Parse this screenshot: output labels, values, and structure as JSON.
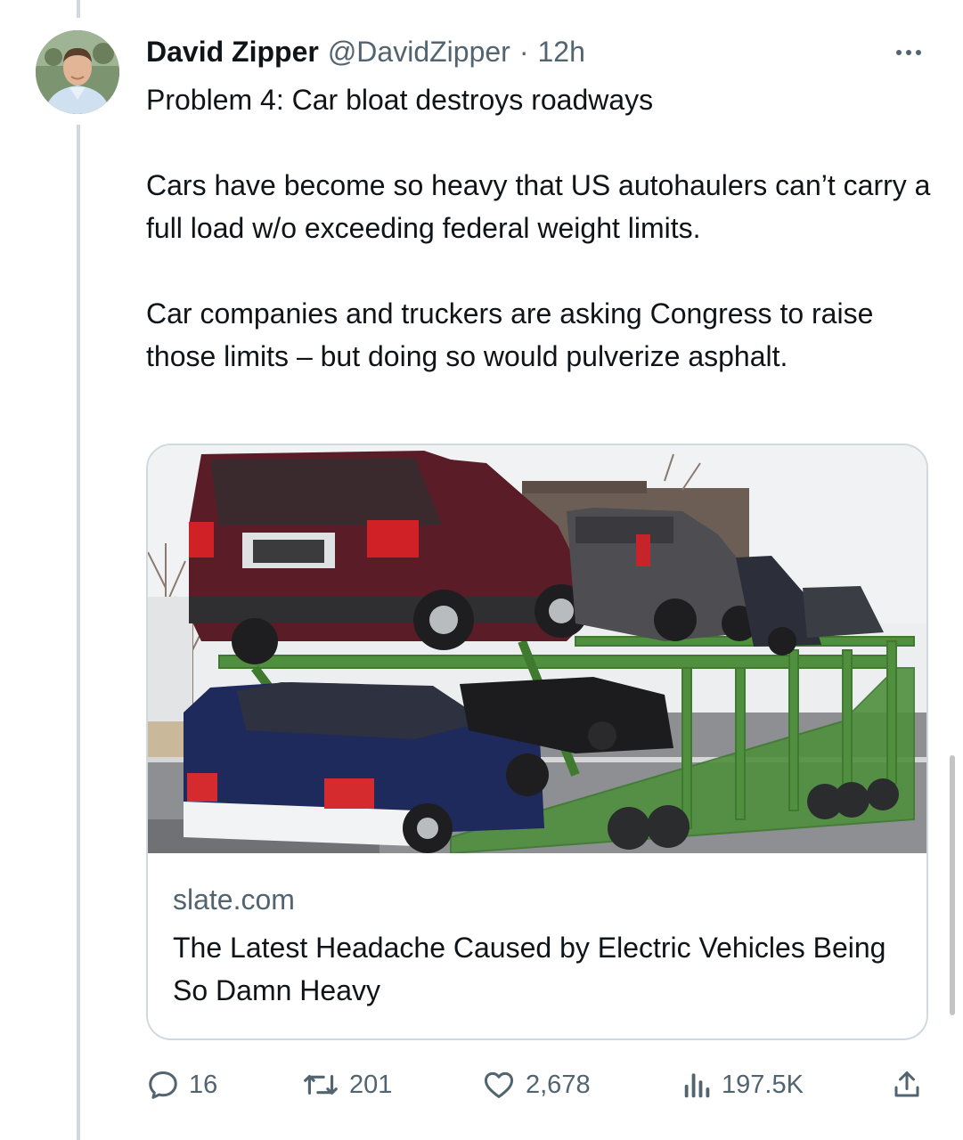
{
  "tweet": {
    "author_name": "David Zipper",
    "author_handle": "@DavidZipper",
    "separator": "·",
    "time": "12h",
    "text": "Problem 4: Car bloat destroys roadways\n\nCars have become so heavy that US autohaulers can’t carry a full load w/o exceeding federal weight limits.\n\nCar companies and truckers are asking Congress to raise those limits – but doing so would pulverize asphalt."
  },
  "card": {
    "domain": "slate.com",
    "title": "The Latest Headache Caused by Electric Vehicles Being So Damn Heavy"
  },
  "actions": {
    "replies": "16",
    "reposts": "201",
    "likes": "2,678",
    "views": "197.5K"
  },
  "icons": {
    "more": "more-icon",
    "reply": "reply-icon",
    "repost": "repost-icon",
    "like": "heart-icon",
    "views": "views-icon",
    "share": "share-icon"
  },
  "colors": {
    "text": "#0f1419",
    "secondary": "#536471",
    "border": "#cfd9de"
  }
}
